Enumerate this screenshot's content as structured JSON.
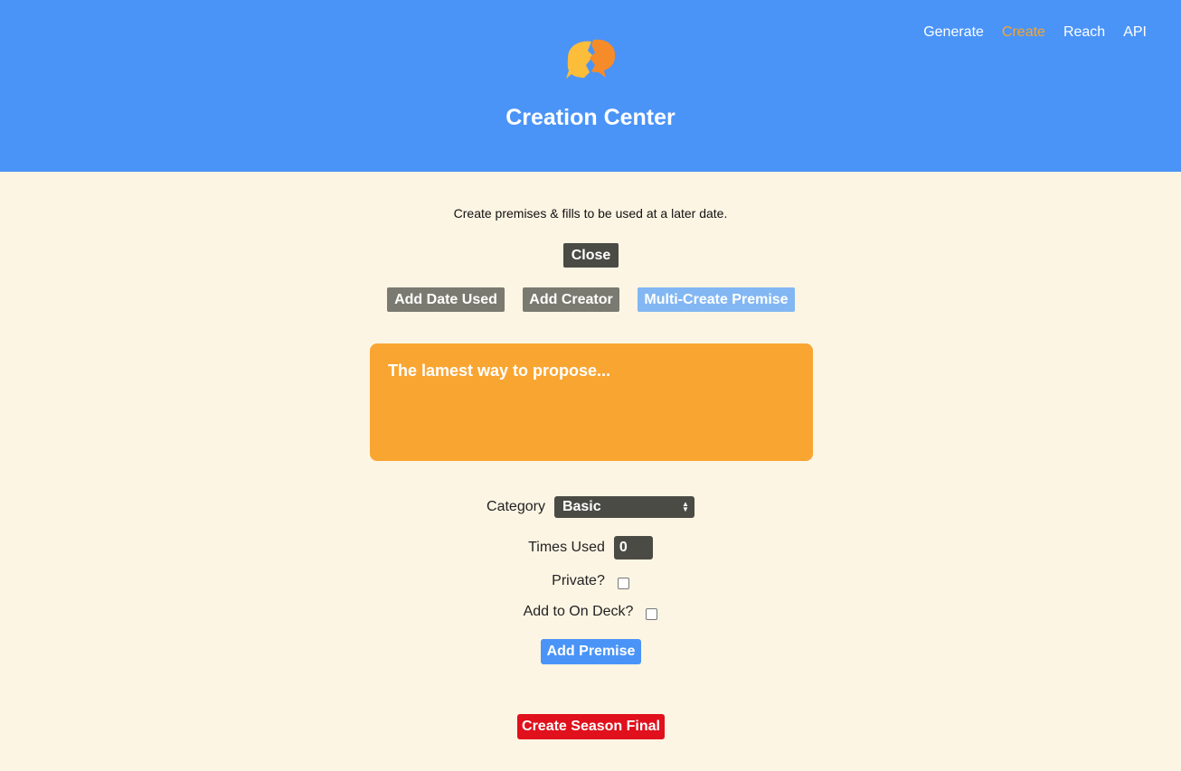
{
  "header": {
    "title": "Creation Center",
    "logo_icon": "speech-bubbles-icon",
    "colors": {
      "background": "#4a94f8",
      "active_nav": "#f7a531"
    }
  },
  "nav": {
    "items": [
      {
        "label": "Generate",
        "active": false
      },
      {
        "label": "Create",
        "active": true
      },
      {
        "label": "Reach",
        "active": false
      },
      {
        "label": "API",
        "active": false
      }
    ]
  },
  "main": {
    "intro": "Create premises & fills to be used at a later date.",
    "close_label": "Close",
    "add_date_label": "Add Date Used",
    "add_creator_label": "Add Creator",
    "multi_create_label": "Multi-Create Premise",
    "premise_value": "The lamest way to propose...",
    "category_label": "Category",
    "category_value": "Basic",
    "times_used_label": "Times Used",
    "times_used_value": "0",
    "private_label": "Private?",
    "private_checked": false,
    "on_deck_label": "Add to On Deck?",
    "on_deck_checked": false,
    "add_premise_label": "Add Premise",
    "season_final_label": "Create Season Final"
  }
}
